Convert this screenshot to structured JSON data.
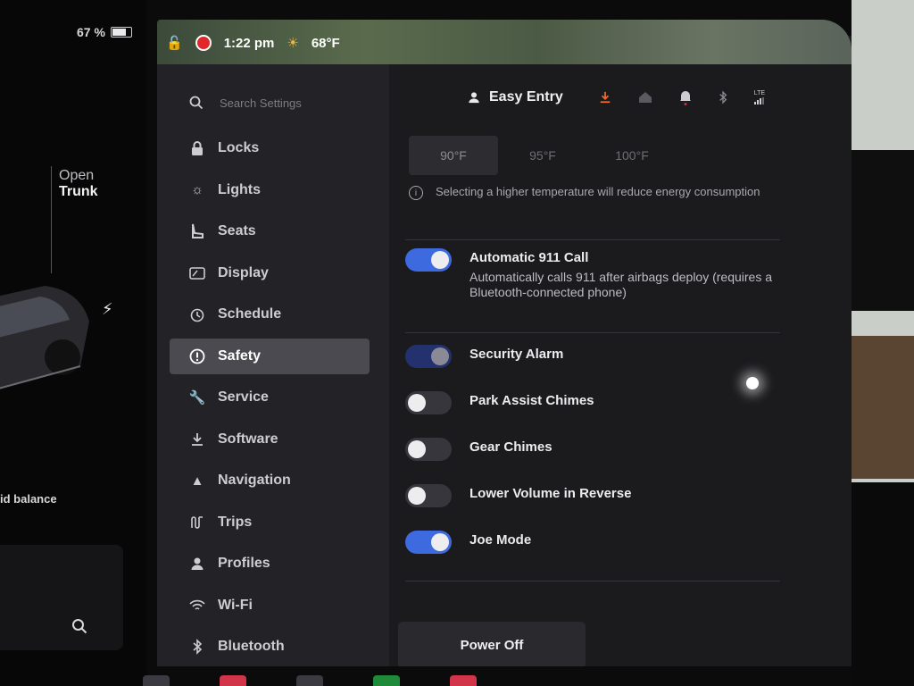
{
  "status": {
    "battery": "67 %",
    "time": "1:22 pm",
    "temperature": "68°F"
  },
  "car_panel": {
    "open_label": "Open",
    "trunk_label": "Trunk",
    "balance_text": "id balance"
  },
  "search": {
    "placeholder": "Search Settings"
  },
  "profile": {
    "name": "Easy Entry"
  },
  "sidebar": {
    "items": [
      {
        "label": "Locks",
        "icon": "lock-icon"
      },
      {
        "label": "Lights",
        "icon": "lights-icon"
      },
      {
        "label": "Seats",
        "icon": "seat-icon"
      },
      {
        "label": "Display",
        "icon": "display-icon"
      },
      {
        "label": "Schedule",
        "icon": "schedule-icon"
      },
      {
        "label": "Safety",
        "icon": "safety-icon",
        "active": true
      },
      {
        "label": "Service",
        "icon": "wrench-icon"
      },
      {
        "label": "Software",
        "icon": "download-icon"
      },
      {
        "label": "Navigation",
        "icon": "navigation-icon"
      },
      {
        "label": "Trips",
        "icon": "trips-icon"
      },
      {
        "label": "Profiles",
        "icon": "profile-icon"
      },
      {
        "label": "Wi-Fi",
        "icon": "wifi-icon"
      },
      {
        "label": "Bluetooth",
        "icon": "bluetooth-icon"
      }
    ]
  },
  "temperature_options": [
    "90°F",
    "95°F",
    "100°F"
  ],
  "temperature_note": "Selecting a higher temperature will reduce energy consumption",
  "settings": {
    "auto911": {
      "label": "Automatic 911 Call",
      "desc": "Automatically calls 911 after airbags deploy (requires a Bluetooth-connected phone)",
      "state": "on"
    },
    "security_alarm": {
      "label": "Security Alarm",
      "state": "on"
    },
    "park_assist": {
      "label": "Park Assist Chimes",
      "state": "off"
    },
    "gear_chimes": {
      "label": "Gear Chimes",
      "state": "off"
    },
    "lower_volume": {
      "label": "Lower Volume in Reverse",
      "state": "off"
    },
    "joe_mode": {
      "label": "Joe Mode",
      "state": "on"
    }
  },
  "power_off": {
    "label": "Power Off"
  },
  "colors": {
    "accent": "#3e6ae0",
    "recording": "#e0282b",
    "download": "#f06a2a"
  },
  "topbar_icons": [
    "download-icon",
    "home-icon",
    "bell-icon",
    "bluetooth-icon",
    "lte-icon"
  ],
  "topbar_lte": "LTE"
}
